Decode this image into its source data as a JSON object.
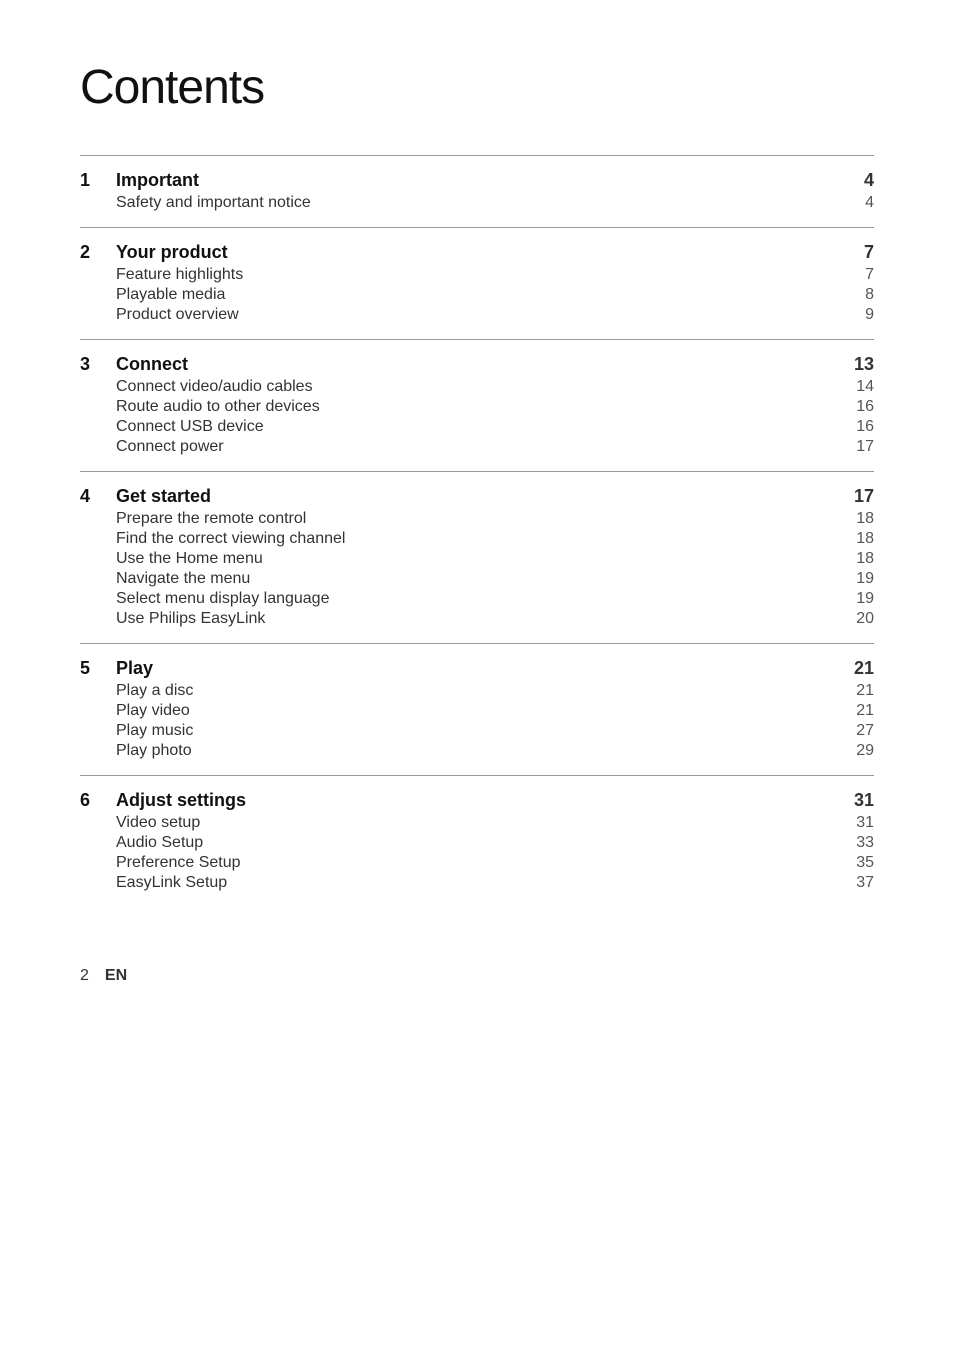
{
  "title": "Contents",
  "sections": [
    {
      "number": "1",
      "title": "Important",
      "page": "4",
      "items": [
        {
          "label": "Safety and important notice",
          "page": "4"
        }
      ]
    },
    {
      "number": "2",
      "title": "Your product",
      "page": "7",
      "items": [
        {
          "label": "Feature highlights",
          "page": "7"
        },
        {
          "label": "Playable media",
          "page": "8"
        },
        {
          "label": "Product overview",
          "page": "9"
        }
      ]
    },
    {
      "number": "3",
      "title": "Connect",
      "page": "13",
      "items": [
        {
          "label": "Connect video/audio cables",
          "page": "14"
        },
        {
          "label": "Route audio to other devices",
          "page": "16"
        },
        {
          "label": "Connect USB device",
          "page": "16"
        },
        {
          "label": "Connect power",
          "page": "17"
        }
      ]
    },
    {
      "number": "4",
      "title": "Get started",
      "page": "17",
      "items": [
        {
          "label": "Prepare the remote control",
          "page": "18"
        },
        {
          "label": "Find the correct viewing channel",
          "page": "18"
        },
        {
          "label": "Use the Home menu",
          "page": "18"
        },
        {
          "label": "Navigate the menu",
          "page": "19"
        },
        {
          "label": "Select menu display language",
          "page": "19"
        },
        {
          "label": "Use Philips EasyLink",
          "page": "20"
        }
      ]
    },
    {
      "number": "5",
      "title": "Play",
      "page": "21",
      "items": [
        {
          "label": "Play a disc",
          "page": "21"
        },
        {
          "label": "Play video",
          "page": "21"
        },
        {
          "label": "Play music",
          "page": "27"
        },
        {
          "label": "Play photo",
          "page": "29"
        }
      ]
    },
    {
      "number": "6",
      "title": "Adjust settings",
      "page": "31",
      "items": [
        {
          "label": "Video setup",
          "page": "31"
        },
        {
          "label": "Audio Setup",
          "page": "33"
        },
        {
          "label": "Preference Setup",
          "page": "35"
        },
        {
          "label": "EasyLink Setup",
          "page": "37"
        }
      ]
    }
  ],
  "footer": {
    "page_number": "2",
    "language": "EN"
  }
}
